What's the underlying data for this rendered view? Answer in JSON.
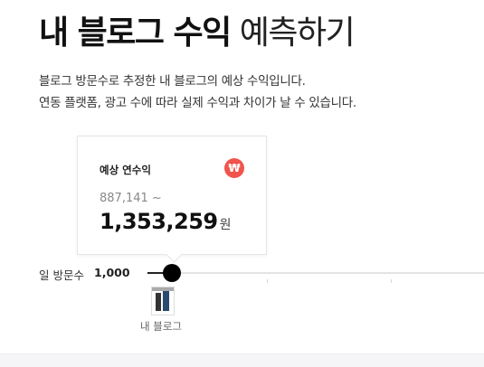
{
  "header": {
    "title_bold": "내 블로그 수익",
    "title_light": "예측하기"
  },
  "description": {
    "line1": "블로그 방문수로 추정한 내 블로그의 예상 수익입니다.",
    "line2": "연동 플랫폼, 광고 수에 따라 실제 수익과 차이가 날 수 있습니다."
  },
  "card": {
    "label": "예상 연수익",
    "badge": "₩",
    "range_start": "887,141 ~",
    "amount": "1,353,259",
    "unit": "원"
  },
  "slider": {
    "label": "일 방문수",
    "value": "1,000",
    "blog_label": "내 블로그"
  },
  "colors": {
    "badge": "#f0544d",
    "thumb": "#000000",
    "track": "#e3e3e3"
  }
}
